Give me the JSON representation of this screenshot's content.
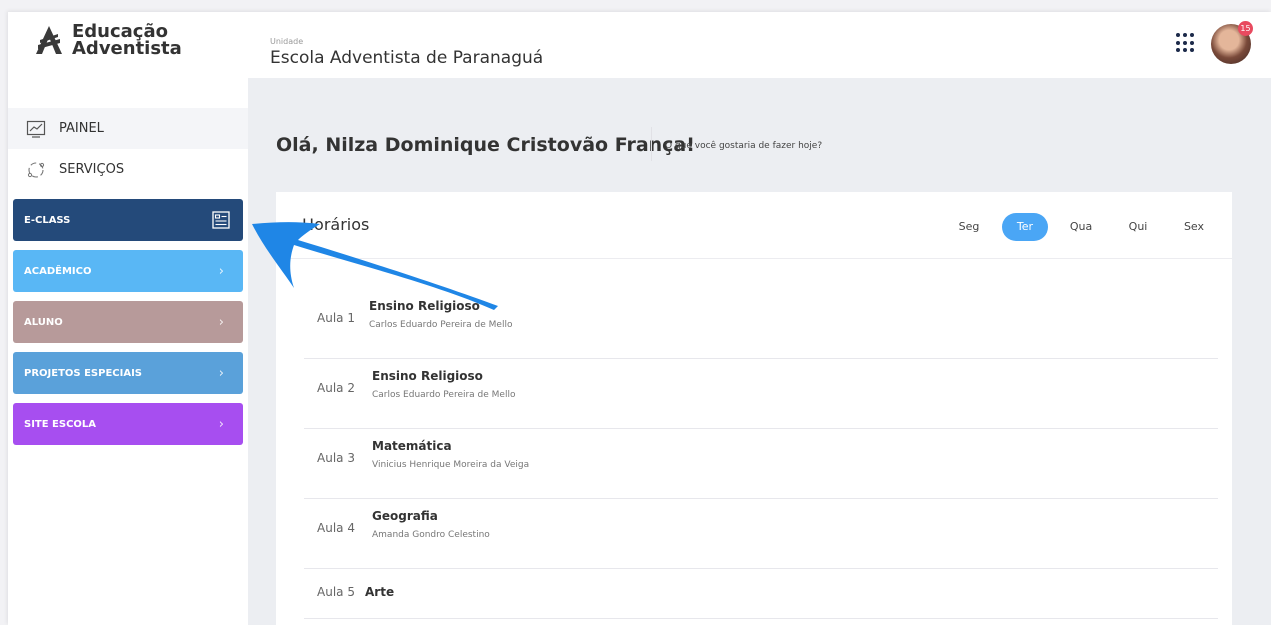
{
  "header": {
    "logo": {
      "line1": "Educação",
      "line2": "Adventista"
    },
    "unit_label": "Unidade",
    "unit_name": "Escola Adventista de Paranaguá",
    "notification_count": "15"
  },
  "sidebar": {
    "nav": [
      {
        "label": "PAINEL",
        "icon": "chart-icon"
      },
      {
        "label": "SERVIÇOS",
        "icon": "services-icon"
      }
    ],
    "menu": [
      {
        "label": "E-CLASS",
        "color": "#244a7a",
        "icon": "eclass-icon"
      },
      {
        "label": "ACADÊMICO",
        "color": "#59b7f5",
        "chevron": "›"
      },
      {
        "label": "ALUNO",
        "color": "#b79a9a",
        "chevron": "›"
      },
      {
        "label": "PROJETOS ESPECIAIS",
        "color": "#5aa1da",
        "chevron": "›"
      },
      {
        "label": "SITE ESCOLA",
        "color": "#a74ef0",
        "chevron": "›"
      }
    ]
  },
  "main": {
    "greeting": "Olá, Nilza Dominique Cristovão França!",
    "greeting_sub": "O que você gostaria de fazer hoje?",
    "schedule": {
      "title": "Horários",
      "days": [
        "Seg",
        "Ter",
        "Qua",
        "Qui",
        "Sex"
      ],
      "active_day": "Ter",
      "lessons": [
        {
          "num": "Aula 1",
          "subject": "Ensino Religioso",
          "teacher": "Carlos Eduardo Pereira de Mello"
        },
        {
          "num": "Aula 2",
          "subject": "Ensino Religioso",
          "teacher": "Carlos Eduardo Pereira de Mello"
        },
        {
          "num": "Aula 3",
          "subject": "Matemática",
          "teacher": "Vinicius Henrique Moreira da Veiga"
        },
        {
          "num": "Aula 4",
          "subject": "Geografia",
          "teacher": "Amanda Gondro Celestino"
        },
        {
          "num": "Aula 5",
          "subject": "Arte",
          "teacher": ""
        }
      ]
    }
  },
  "colors": {
    "accent": "#4aa6f5",
    "annotation_arrow": "#1f86e6"
  }
}
